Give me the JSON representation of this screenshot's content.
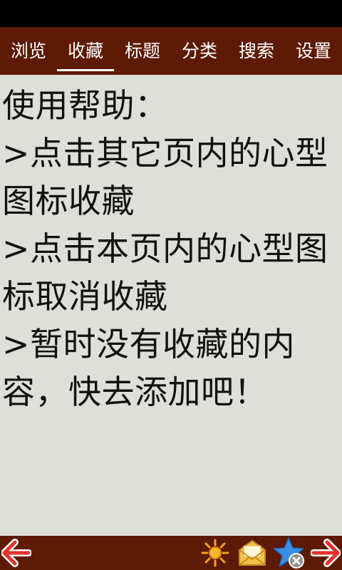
{
  "tabs": [
    {
      "label": "浏览",
      "active": false
    },
    {
      "label": "收藏",
      "active": true
    },
    {
      "label": "标题",
      "active": false
    },
    {
      "label": "分类",
      "active": false
    },
    {
      "label": "搜索",
      "active": false
    },
    {
      "label": "设置",
      "active": false
    }
  ],
  "help": {
    "title": "使用帮助：",
    "items": [
      ">点击其它页内的心型图标收藏",
      ">点击本页内的心型图标取消收藏",
      ">暂时没有收藏的内容，快去添加吧！"
    ]
  },
  "toolbar": {
    "icons": [
      "back-arrow-icon",
      "sun-icon",
      "envelope-icon",
      "star-remove-icon",
      "forward-arrow-icon"
    ]
  },
  "colors": {
    "bar_background": "#5d1a04",
    "content_background": "#dfdfd9",
    "arrow_red": "#e8302a",
    "sun_orange": "#f5a21c",
    "envelope_gold": "#f3c24b",
    "star_blue": "#3a8ee6"
  }
}
